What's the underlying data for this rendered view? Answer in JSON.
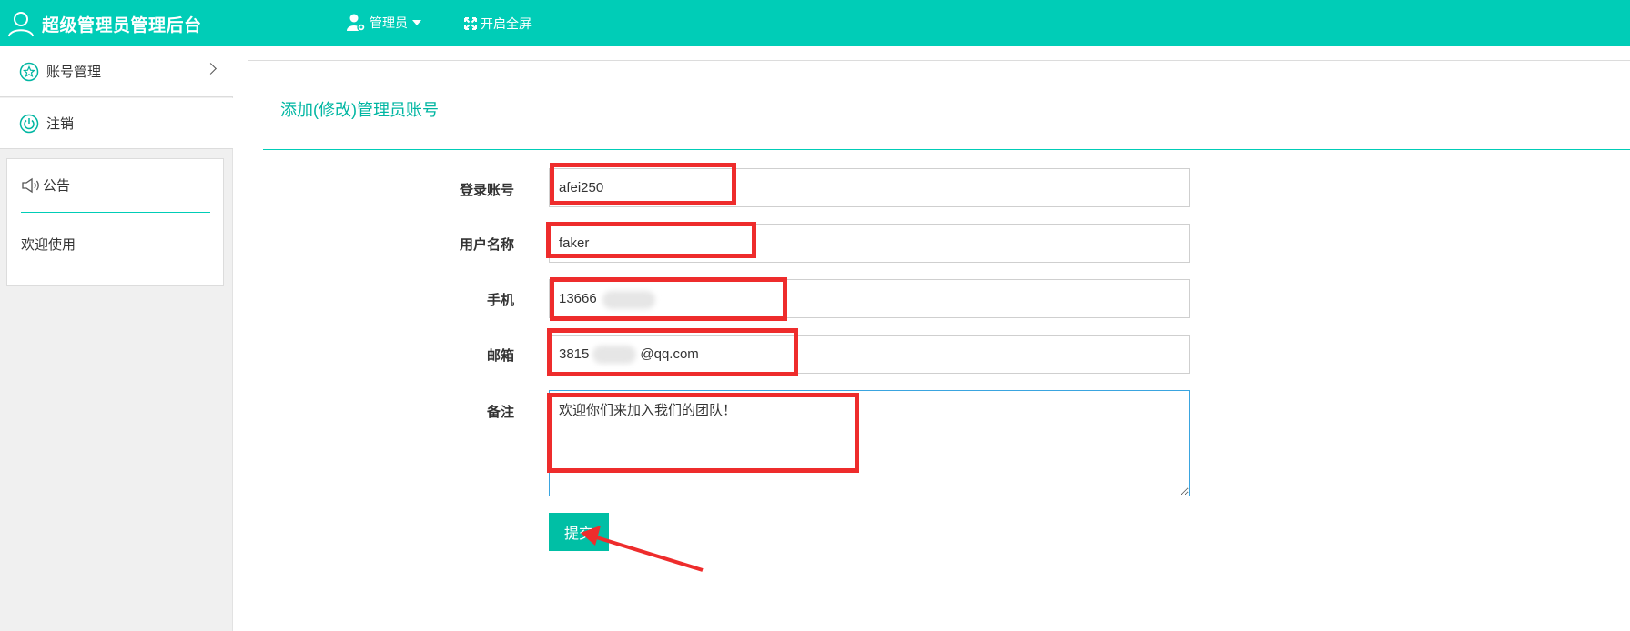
{
  "header": {
    "title": "超级管理员管理后台",
    "admin_label": "管理员",
    "fullscreen_label": "开启全屏",
    "background": "#00cdb7"
  },
  "sidebar": {
    "items": [
      {
        "label": "账号管理",
        "icon": "star-circle-icon",
        "has_submenu": true
      },
      {
        "label": "注销",
        "icon": "power-icon",
        "has_submenu": false
      }
    ],
    "notice": {
      "title": "公告",
      "icon": "megaphone-icon",
      "body": "欢迎使用"
    }
  },
  "form": {
    "title": "添加(修改)管理员账号",
    "fields": [
      {
        "label": "登录账号",
        "value": "afei250"
      },
      {
        "label": "用户名称",
        "value": "faker"
      },
      {
        "label": "手机",
        "value": "13666"
      },
      {
        "label": "邮箱",
        "value_prefix": "3815",
        "value_suffix": "@qq.com"
      },
      {
        "label": "备注",
        "value": "欢迎你们来加入我们的团队！"
      }
    ],
    "submit_label": "提交"
  },
  "annotations": {
    "highlight_color": "#ee2c2c",
    "arrow_target": "submit-button"
  }
}
